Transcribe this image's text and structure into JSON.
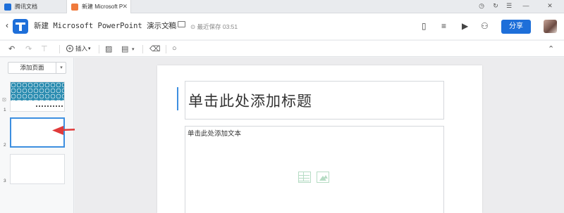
{
  "tabs": [
    {
      "label": "腾讯文档",
      "icon": "tencent-docs-icon"
    },
    {
      "label": "新建 Microsoft P",
      "icon": "ppt-doc-icon",
      "close": "✕"
    }
  ],
  "window_controls": {
    "history": "◷",
    "refresh": "↻",
    "menu": "☰",
    "minimize": "—",
    "close": "✕"
  },
  "header": {
    "back": "‹",
    "title": "新建 Microsoft PowerPoint 演示文稿",
    "star": "☆",
    "saved": "最近保存 03:51",
    "share": "分享"
  },
  "toolbar": {
    "undo": "↶",
    "redo": "↷",
    "insert": "插入",
    "insert_caret": "▾",
    "collapse": "⌃",
    "search": "○"
  },
  "sidebar": {
    "add_page": "添加页面",
    "add_page_caret": "▾",
    "slides": [
      {
        "num": "1"
      },
      {
        "num": "2"
      },
      {
        "num": "3"
      }
    ]
  },
  "slide": {
    "title_placeholder": "单击此处添加标题",
    "body_placeholder": "单击此处添加文本"
  },
  "colors": {
    "accent": "#1e6fd9",
    "selection": "#3d8fe0",
    "arrow": "#e03a3a"
  }
}
